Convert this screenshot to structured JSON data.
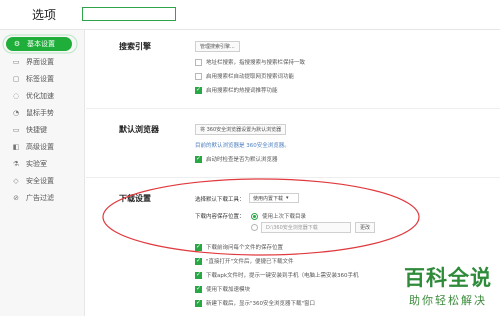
{
  "header": {
    "title": "选项",
    "search_placeholder": ""
  },
  "sidebar": {
    "items": [
      {
        "label": "基本设置",
        "icon": "gear-icon",
        "active": true
      },
      {
        "label": "界面设置",
        "icon": "window-icon"
      },
      {
        "label": "标签设置",
        "icon": "tag-icon"
      },
      {
        "label": "优化加速",
        "icon": "rocket-icon"
      },
      {
        "label": "鼠标手势",
        "icon": "mouse-icon"
      },
      {
        "label": "快捷键",
        "icon": "keyboard-icon"
      },
      {
        "label": "高级设置",
        "icon": "advanced-icon"
      },
      {
        "label": "实验室",
        "icon": "flask-icon"
      },
      {
        "label": "安全设置",
        "icon": "shield-icon"
      },
      {
        "label": "广告过滤",
        "icon": "block-icon"
      }
    ]
  },
  "search_engine": {
    "title": "搜索引擎",
    "manage_button": "管理搜索引擎...",
    "options": [
      {
        "label": "地址栏搜索，指搜搜索与搜索栏保持一致",
        "checked": false
      },
      {
        "label": "启用搜索栏自动提取网页搜索词功能",
        "checked": false
      },
      {
        "label": "启用搜索栏的热搜词推荐功能",
        "checked": true
      }
    ]
  },
  "default_browser": {
    "title": "默认浏览器",
    "set_button": "将 360安全浏览器设置为默认浏览器",
    "status": "目前的默认浏览器是 360安全浏览器。",
    "auto_check": {
      "label": "启动时检查是否为默认浏览器",
      "checked": true
    }
  },
  "download": {
    "title": "下载设置",
    "tool_label": "选择默认下载工具：",
    "tool_value": "使用内置下载",
    "save_label": "下载内容保存位置：",
    "radio_last": "使用上次下载目录",
    "path_value": "D:\\360安全浏览器下载",
    "browse_button": "更改",
    "options": [
      {
        "label": "下载前询问每个文件的保存位置",
        "checked": true
      },
      {
        "label": "\"直接打开\"文件后，便捷已下载文件",
        "checked": true
      },
      {
        "label": "下载apk文件时，提示一键安装到手机（电脑上需安装360手机",
        "checked": true
      },
      {
        "label": "使用下载加速模块",
        "checked": true
      },
      {
        "label": "新建下载后，显示\"360安全浏览器下载\"窗口",
        "checked": true
      }
    ]
  },
  "watermark": {
    "line1": "百科全说",
    "line2": "助你轻松解决"
  },
  "colors": {
    "accent": "#1fae3a",
    "annotation": "#e0393e"
  }
}
